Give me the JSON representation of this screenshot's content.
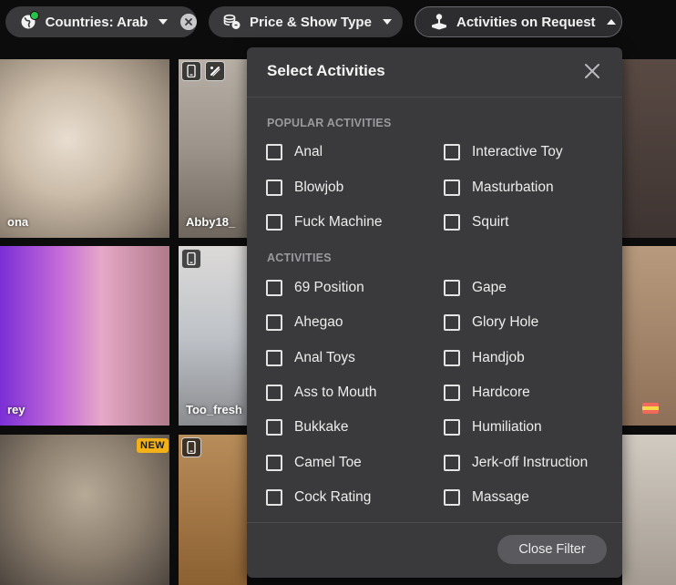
{
  "filters": {
    "countries_label": "Countries: Arab",
    "price_label": "Price & Show Type",
    "activities_label": "Activities on Request"
  },
  "icons": {
    "globe": "globe-icon",
    "clear": "clear-filter-icon",
    "coins": "price-coins-icon",
    "joystick": "joystick-icon",
    "mobile": "mobile-icon",
    "interactive": "interactive-toy-icon",
    "close": "close-icon"
  },
  "colors": {
    "accent_green": "#27c24c",
    "panel_bg": "#3a3a3c",
    "new_badge": "#f3b118"
  },
  "tiles": [
    {
      "name": "ona"
    },
    {
      "name": "Abby18_"
    },
    {
      "name": "rey"
    },
    {
      "name": "Too_fresh"
    }
  ],
  "badges": {
    "new_label": "NEW"
  },
  "panel": {
    "title": "Select Activities",
    "popular_title": "POPULAR ACTIVITIES",
    "popular": [
      "Anal",
      "Interactive Toy",
      "Blowjob",
      "Masturbation",
      "Fuck Machine",
      "Squirt"
    ],
    "activities_title": "ACTIVITIES",
    "activities": [
      "69 Position",
      "Gape",
      "Ahegao",
      "Glory Hole",
      "Anal Toys",
      "Handjob",
      "Ass to Mouth",
      "Hardcore",
      "Bukkake",
      "Humiliation",
      "Camel Toe",
      "Jerk-off Instruction",
      "Cock Rating",
      "Massage"
    ],
    "close_filter_label": "Close Filter"
  }
}
